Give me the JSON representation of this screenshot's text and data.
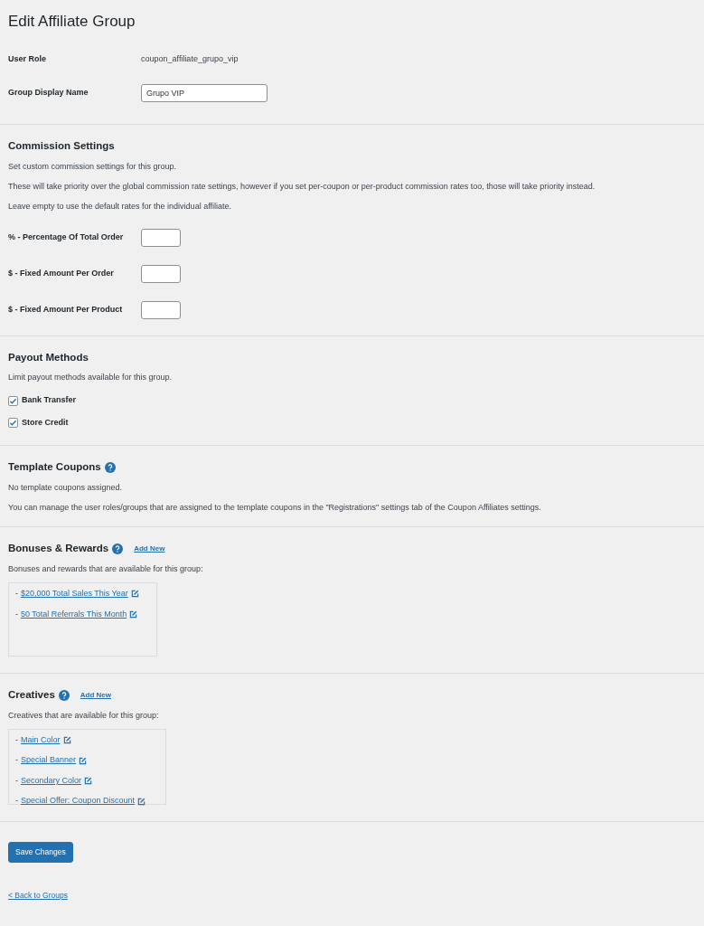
{
  "title": "Edit Affiliate Group",
  "user_role": {
    "label": "User Role",
    "value": "coupon_affiliate_grupo_vip"
  },
  "group_display_name": {
    "label": "Group Display Name",
    "value": "Grupo VIP"
  },
  "commission": {
    "heading": "Commission Settings",
    "paragraphs": [
      "Set custom commission settings for this group.",
      "These will take priority over the global commission rate settings, however if you set per-coupon or per-product commission rates too, those will take priority instead.",
      "Leave empty to use the default rates for the individual affiliate."
    ],
    "rates": [
      {
        "label": "% - Percentage Of Total Order"
      },
      {
        "label": "$ - Fixed Amount Per Order"
      },
      {
        "label": "$ - Fixed Amount Per Product"
      }
    ]
  },
  "payout": {
    "heading": "Payout Methods",
    "description": "Limit payout methods available for this group.",
    "methods": [
      {
        "label": "Bank Transfer",
        "checked": true
      },
      {
        "label": "Store Credit",
        "checked": true
      }
    ]
  },
  "template_coupons": {
    "heading": "Template Coupons",
    "paragraphs": [
      "No template coupons assigned.",
      "You can manage the user roles/groups that are assigned to the template coupons in the \"Registrations\" settings tab of the Coupon Affiliates settings."
    ]
  },
  "bonuses": {
    "heading": "Bonuses & Rewards",
    "add_new": "Add New",
    "description": "Bonuses and rewards that are available for this group:",
    "items": [
      {
        "prefix": "-",
        "label": "$20,000 Total Sales This Year"
      },
      {
        "prefix": "-",
        "label": "50 Total Referrals This Month"
      }
    ]
  },
  "creatives": {
    "heading": "Creatives",
    "add_new": "Add New",
    "description": "Creatives that are available for this group:",
    "items": [
      {
        "prefix": "-",
        "label": "Main Color"
      },
      {
        "prefix": "-",
        "label": "Special Banner"
      },
      {
        "prefix": "-",
        "label": "Secondary Color"
      },
      {
        "prefix": "-",
        "label": "Special Offer: Coupon Discount"
      }
    ]
  },
  "save_button": "Save Changes",
  "back_link": "< Back to Groups"
}
